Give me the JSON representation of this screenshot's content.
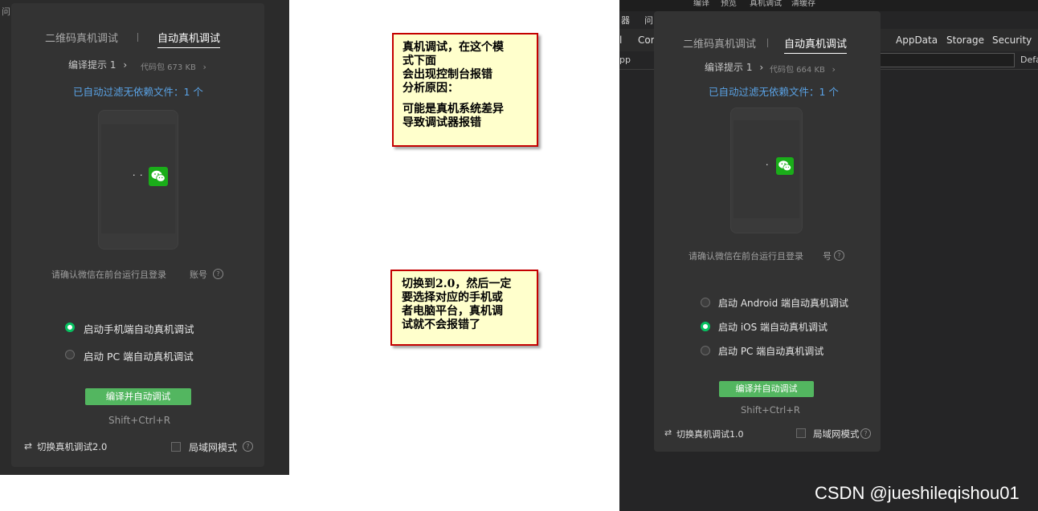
{
  "left_window": {
    "top_strip_text": "问",
    "tabs": [
      "二维码真机调试",
      "自动真机调试"
    ],
    "compile_tip": "编译提示 1",
    "package_size": "代码包 673 KB",
    "filter_note": "已自动过滤无依赖文件：1 个",
    "confirm_text": "请确认微信在前台运行且登录",
    "confirm_account": "账号",
    "radio_options": [
      "启动手机端自动真机调试",
      "启动 PC 端自动真机调试"
    ],
    "selected_option": 0,
    "compile_button": "编译并自动调试",
    "shortcut": "Shift+Ctrl+R",
    "switch_label": "切换真机调试2.0",
    "lan_label": "局域网模式"
  },
  "notes": [
    {
      "paragraphs": [
        "真机调试，在这个模\n式下面\n会出现控制台报错\n分析原因：",
        "可能是真机系统差异\n导致调试器报错"
      ]
    },
    {
      "paragraphs": [
        "切换到2.0，然后一定\n要选择对应的手机或\n者电脑平台，真机调\n试就不会报错了"
      ]
    }
  ],
  "right_window": {
    "menu_strip": [
      "编译",
      "预览",
      "真机调试",
      "清缓存"
    ],
    "side_label_top": "器",
    "side_label_top2": "问",
    "devtools_tabs": [
      "AppData",
      "Storage",
      "Security"
    ],
    "devtools_partial_left": [
      "l",
      "Con"
    ],
    "filter_left": "pp",
    "filter_right": "Defa",
    "tabs": [
      "二维码真机调试",
      "自动真机调试"
    ],
    "compile_tip": "编译提示 1",
    "package_size": "代码包 664 KB",
    "filter_note": "已自动过滤无依赖文件：1 个",
    "confirm_text": "请确认微信在前台运行且登录",
    "confirm_account": "号",
    "radio_options": [
      "启动 Android 端自动真机调试",
      "启动 iOS 端自动真机调试",
      "启动 PC 端自动真机调试"
    ],
    "selected_option": 1,
    "compile_button": "编译并自动调试",
    "shortcut": "Shift+Ctrl+R",
    "switch_label": "切换真机调试1.0",
    "lan_label": "局域网模式"
  },
  "watermark": "CSDN @jueshileqishou01",
  "colors": {
    "accent_green": "#07c160",
    "button_green": "#53b660",
    "link_blue": "#5aa3e6",
    "note_border": "#c40000",
    "note_bg": "#ffffcc"
  }
}
